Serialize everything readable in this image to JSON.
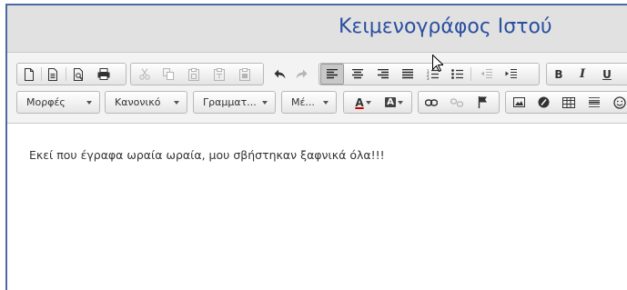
{
  "window": {
    "title": "Κειμενογράφος Ιστού"
  },
  "toolbar": {
    "formats_combo": "Μορφές",
    "paragraph_combo": "Κανονικό",
    "font_family_combo": "Γραμματ...",
    "font_size_combo": "Μέ...",
    "bold_label": "B",
    "italic_label": "I",
    "underline_label": "U",
    "text_color_label": "A",
    "bg_color_label": "A"
  },
  "editor": {
    "content": "Εκεί που έγραφα ωραία ωραία, μου σβήστηκαν ξαφνικά όλα!!!"
  },
  "colors": {
    "title": "#2a4fa0",
    "frame_border": "#4a6aa5",
    "toolbar_bg": "#f3f3f3",
    "text_color_underline": "#d00000"
  },
  "icons": {
    "row1": [
      "new-document-icon",
      "template-document-icon",
      "preview-icon",
      "print-icon",
      "cut-icon",
      "copy-icon",
      "paste-icon",
      "paste-text-icon",
      "paste-word-icon",
      "undo-icon",
      "redo-icon",
      "align-left-icon",
      "align-center-icon",
      "align-right-icon",
      "align-justify-icon",
      "numbered-list-icon",
      "bullet-list-icon",
      "outdent-icon",
      "indent-icon",
      "bold-icon",
      "italic-icon",
      "underline-icon",
      "strikethrough-icon"
    ],
    "row2": [
      "text-color-icon",
      "background-color-icon",
      "link-icon",
      "unlink-icon",
      "anchor-flag-icon",
      "image-icon",
      "media-icon",
      "table-icon",
      "horizontal-rule-icon",
      "emoticon-icon"
    ]
  }
}
